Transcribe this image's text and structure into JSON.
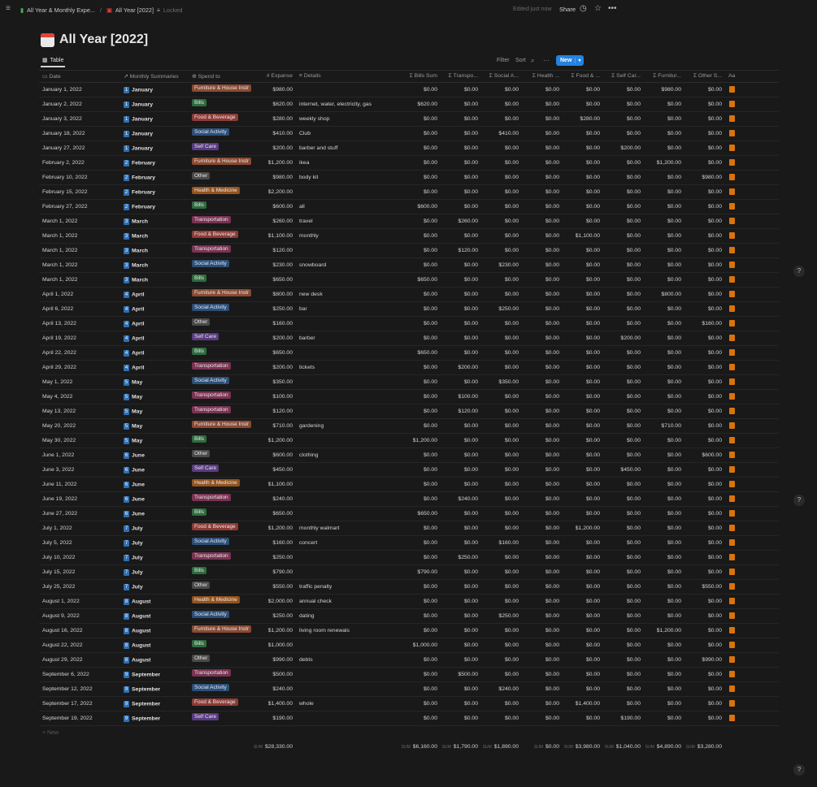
{
  "topbar": {
    "breadcrumb_parent": "All Year & Monthly Expe...",
    "breadcrumb_sep": "/",
    "breadcrumb_current": "All Year [2022]",
    "locked": "Locked",
    "edited": "Edited just now",
    "share": "Share"
  },
  "page": {
    "title": "All Year [2022]"
  },
  "view": {
    "tab": "Table",
    "filter": "Filter",
    "sort": "Sort",
    "new": "New"
  },
  "columns": [
    "Date",
    "Monthly Summaries",
    "Spend to",
    "Expanse",
    "Details",
    "Bills Sum",
    "Transpo...",
    "Social A...",
    "Health ...",
    "Food & ...",
    "Self Car...",
    "Furnitur...",
    "Other S...",
    "Aa"
  ],
  "tag_colors": {
    "Furniture & House Instr": "#8a4a33",
    "Bills": "#2e6b3e",
    "Food & Beverage": "#8e3b36",
    "Social Activity": "#2b4f7a",
    "Self Care": "#5a3b82",
    "Other": "#4a4a4a",
    "Health & Medicine": "#93531e",
    "Transportation": "#7a3352"
  },
  "rows": [
    {
      "date": "January 1, 2022",
      "mnum": "1",
      "month": "January",
      "tag": "Furniture & House Instr",
      "exp": "$980.00",
      "details": "",
      "vals": [
        "$0.00",
        "$0.00",
        "$0.00",
        "$0.00",
        "$0.00",
        "$0.00",
        "$980.00",
        "$0.00"
      ]
    },
    {
      "date": "January 2, 2022",
      "mnum": "1",
      "month": "January",
      "tag": "Bills",
      "exp": "$620.00",
      "details": "internet, water, electricity, gas",
      "vals": [
        "$620.00",
        "$0.00",
        "$0.00",
        "$0.00",
        "$0.00",
        "$0.00",
        "$0.00",
        "$0.00"
      ]
    },
    {
      "date": "January 3, 2022",
      "mnum": "1",
      "month": "January",
      "tag": "Food & Beverage",
      "exp": "$280.00",
      "details": "weekly shop",
      "vals": [
        "$0.00",
        "$0.00",
        "$0.00",
        "$0.00",
        "$280.00",
        "$0.00",
        "$0.00",
        "$0.00"
      ]
    },
    {
      "date": "January 18, 2022",
      "mnum": "1",
      "month": "January",
      "tag": "Social Activity",
      "exp": "$410.00",
      "details": "Club",
      "vals": [
        "$0.00",
        "$0.00",
        "$410.00",
        "$0.00",
        "$0.00",
        "$0.00",
        "$0.00",
        "$0.00"
      ]
    },
    {
      "date": "January 27, 2022",
      "mnum": "1",
      "month": "January",
      "tag": "Self Care",
      "exp": "$200.00",
      "details": "barber and stuff",
      "vals": [
        "$0.00",
        "$0.00",
        "$0.00",
        "$0.00",
        "$0.00",
        "$200.00",
        "$0.00",
        "$0.00"
      ]
    },
    {
      "date": "February 2, 2022",
      "mnum": "2",
      "month": "February",
      "tag": "Furniture & House Instr",
      "exp": "$1,200.00",
      "details": "ikea",
      "vals": [
        "$0.00",
        "$0.00",
        "$0.00",
        "$0.00",
        "$0.00",
        "$0.00",
        "$1,200.00",
        "$0.00"
      ]
    },
    {
      "date": "February 10, 2022",
      "mnum": "2",
      "month": "February",
      "tag": "Other",
      "exp": "$980.00",
      "details": "body kit",
      "vals": [
        "$0.00",
        "$0.00",
        "$0.00",
        "$0.00",
        "$0.00",
        "$0.00",
        "$0.00",
        "$980.00"
      ]
    },
    {
      "date": "February 15, 2022",
      "mnum": "2",
      "month": "February",
      "tag": "Health & Medicine",
      "exp": "$2,200.00",
      "details": "",
      "vals": [
        "$0.00",
        "$0.00",
        "$0.00",
        "$0.00",
        "$0.00",
        "$0.00",
        "$0.00",
        "$0.00"
      ]
    },
    {
      "date": "February 27, 2022",
      "mnum": "2",
      "month": "February",
      "tag": "Bills",
      "exp": "$600.00",
      "details": "all",
      "vals": [
        "$600.00",
        "$0.00",
        "$0.00",
        "$0.00",
        "$0.00",
        "$0.00",
        "$0.00",
        "$0.00"
      ]
    },
    {
      "date": "March 1, 2022",
      "mnum": "3",
      "month": "March",
      "tag": "Transportation",
      "exp": "$260.00",
      "details": "travel",
      "vals": [
        "$0.00",
        "$260.00",
        "$0.00",
        "$0.00",
        "$0.00",
        "$0.00",
        "$0.00",
        "$0.00"
      ]
    },
    {
      "date": "March 1, 2022",
      "mnum": "3",
      "month": "March",
      "tag": "Food & Beverage",
      "exp": "$1,100.00",
      "details": "monthly",
      "vals": [
        "$0.00",
        "$0.00",
        "$0.00",
        "$0.00",
        "$1,100.00",
        "$0.00",
        "$0.00",
        "$0.00"
      ]
    },
    {
      "date": "March 1, 2022",
      "mnum": "3",
      "month": "March",
      "tag": "Transportation",
      "exp": "$120.00",
      "details": "",
      "vals": [
        "$0.00",
        "$120.00",
        "$0.00",
        "$0.00",
        "$0.00",
        "$0.00",
        "$0.00",
        "$0.00"
      ]
    },
    {
      "date": "March 1, 2022",
      "mnum": "3",
      "month": "March",
      "tag": "Social Activity",
      "exp": "$230.00",
      "details": "snowboard",
      "vals": [
        "$0.00",
        "$0.00",
        "$230.00",
        "$0.00",
        "$0.00",
        "$0.00",
        "$0.00",
        "$0.00"
      ]
    },
    {
      "date": "March 1, 2022",
      "mnum": "3",
      "month": "March",
      "tag": "Bills",
      "exp": "$650.00",
      "details": "",
      "vals": [
        "$650.00",
        "$0.00",
        "$0.00",
        "$0.00",
        "$0.00",
        "$0.00",
        "$0.00",
        "$0.00"
      ]
    },
    {
      "date": "April 1, 2022",
      "mnum": "4",
      "month": "April",
      "tag": "Furniture & House Instr",
      "exp": "$800.00",
      "details": "new desk",
      "vals": [
        "$0.00",
        "$0.00",
        "$0.00",
        "$0.00",
        "$0.00",
        "$0.00",
        "$800.00",
        "$0.00"
      ]
    },
    {
      "date": "April 6, 2022",
      "mnum": "4",
      "month": "April",
      "tag": "Social Activity",
      "exp": "$250.00",
      "details": "bar",
      "vals": [
        "$0.00",
        "$0.00",
        "$250.00",
        "$0.00",
        "$0.00",
        "$0.00",
        "$0.00",
        "$0.00"
      ]
    },
    {
      "date": "April 13, 2022",
      "mnum": "4",
      "month": "April",
      "tag": "Other",
      "exp": "$160.00",
      "details": "",
      "vals": [
        "$0.00",
        "$0.00",
        "$0.00",
        "$0.00",
        "$0.00",
        "$0.00",
        "$0.00",
        "$160.00"
      ]
    },
    {
      "date": "April 19, 2022",
      "mnum": "4",
      "month": "April",
      "tag": "Self Care",
      "exp": "$200.00",
      "details": "barber",
      "vals": [
        "$0.00",
        "$0.00",
        "$0.00",
        "$0.00",
        "$0.00",
        "$200.00",
        "$0.00",
        "$0.00"
      ]
    },
    {
      "date": "April 22, 2022",
      "mnum": "4",
      "month": "April",
      "tag": "Bills",
      "exp": "$650.00",
      "details": "",
      "vals": [
        "$650.00",
        "$0.00",
        "$0.00",
        "$0.00",
        "$0.00",
        "$0.00",
        "$0.00",
        "$0.00"
      ]
    },
    {
      "date": "April 29, 2022",
      "mnum": "4",
      "month": "April",
      "tag": "Transportation",
      "exp": "$200.00",
      "details": "tickets",
      "vals": [
        "$0.00",
        "$200.00",
        "$0.00",
        "$0.00",
        "$0.00",
        "$0.00",
        "$0.00",
        "$0.00"
      ]
    },
    {
      "date": "May 1, 2022",
      "mnum": "5",
      "month": "May",
      "tag": "Social Activity",
      "exp": "$350.00",
      "details": "",
      "vals": [
        "$0.00",
        "$0.00",
        "$350.00",
        "$0.00",
        "$0.00",
        "$0.00",
        "$0.00",
        "$0.00"
      ]
    },
    {
      "date": "May 4, 2022",
      "mnum": "5",
      "month": "May",
      "tag": "Transportation",
      "exp": "$100.00",
      "details": "",
      "vals": [
        "$0.00",
        "$100.00",
        "$0.00",
        "$0.00",
        "$0.00",
        "$0.00",
        "$0.00",
        "$0.00"
      ]
    },
    {
      "date": "May 13, 2022",
      "mnum": "5",
      "month": "May",
      "tag": "Transportation",
      "exp": "$120.00",
      "details": "",
      "vals": [
        "$0.00",
        "$120.00",
        "$0.00",
        "$0.00",
        "$0.00",
        "$0.00",
        "$0.00",
        "$0.00"
      ]
    },
    {
      "date": "May 20, 2022",
      "mnum": "5",
      "month": "May",
      "tag": "Furniture & House Instr",
      "exp": "$710.00",
      "details": "gardening",
      "vals": [
        "$0.00",
        "$0.00",
        "$0.00",
        "$0.00",
        "$0.00",
        "$0.00",
        "$710.00",
        "$0.00"
      ]
    },
    {
      "date": "May 30, 2022",
      "mnum": "5",
      "month": "May",
      "tag": "Bills",
      "exp": "$1,200.00",
      "details": "",
      "vals": [
        "$1,200.00",
        "$0.00",
        "$0.00",
        "$0.00",
        "$0.00",
        "$0.00",
        "$0.00",
        "$0.00"
      ]
    },
    {
      "date": "June 1, 2022",
      "mnum": "6",
      "month": "June",
      "tag": "Other",
      "exp": "$600.00",
      "details": "clothing",
      "vals": [
        "$0.00",
        "$0.00",
        "$0.00",
        "$0.00",
        "$0.00",
        "$0.00",
        "$0.00",
        "$600.00"
      ]
    },
    {
      "date": "June 3, 2022",
      "mnum": "6",
      "month": "June",
      "tag": "Self Care",
      "exp": "$450.00",
      "details": "",
      "vals": [
        "$0.00",
        "$0.00",
        "$0.00",
        "$0.00",
        "$0.00",
        "$450.00",
        "$0.00",
        "$0.00"
      ]
    },
    {
      "date": "June 11, 2022",
      "mnum": "6",
      "month": "June",
      "tag": "Health & Medicine",
      "exp": "$1,100.00",
      "details": "",
      "vals": [
        "$0.00",
        "$0.00",
        "$0.00",
        "$0.00",
        "$0.00",
        "$0.00",
        "$0.00",
        "$0.00"
      ]
    },
    {
      "date": "June 19, 2022",
      "mnum": "6",
      "month": "June",
      "tag": "Transportation",
      "exp": "$240.00",
      "details": "",
      "vals": [
        "$0.00",
        "$240.00",
        "$0.00",
        "$0.00",
        "$0.00",
        "$0.00",
        "$0.00",
        "$0.00"
      ]
    },
    {
      "date": "June 27, 2022",
      "mnum": "6",
      "month": "June",
      "tag": "Bills",
      "exp": "$650.00",
      "details": "",
      "vals": [
        "$650.00",
        "$0.00",
        "$0.00",
        "$0.00",
        "$0.00",
        "$0.00",
        "$0.00",
        "$0.00"
      ]
    },
    {
      "date": "July 1, 2022",
      "mnum": "7",
      "month": "July",
      "tag": "Food & Beverage",
      "exp": "$1,200.00",
      "details": "monthly walmart",
      "vals": [
        "$0.00",
        "$0.00",
        "$0.00",
        "$0.00",
        "$1,200.00",
        "$0.00",
        "$0.00",
        "$0.00"
      ]
    },
    {
      "date": "July 5, 2022",
      "mnum": "7",
      "month": "July",
      "tag": "Social Activity",
      "exp": "$160.00",
      "details": "concert",
      "vals": [
        "$0.00",
        "$0.00",
        "$160.00",
        "$0.00",
        "$0.00",
        "$0.00",
        "$0.00",
        "$0.00"
      ]
    },
    {
      "date": "July 10, 2022",
      "mnum": "7",
      "month": "July",
      "tag": "Transportation",
      "exp": "$250.00",
      "details": "",
      "vals": [
        "$0.00",
        "$250.00",
        "$0.00",
        "$0.00",
        "$0.00",
        "$0.00",
        "$0.00",
        "$0.00"
      ]
    },
    {
      "date": "July 15, 2022",
      "mnum": "7",
      "month": "July",
      "tag": "Bills",
      "exp": "$790.00",
      "details": "",
      "vals": [
        "$790.00",
        "$0.00",
        "$0.00",
        "$0.00",
        "$0.00",
        "$0.00",
        "$0.00",
        "$0.00"
      ]
    },
    {
      "date": "July 25, 2022",
      "mnum": "7",
      "month": "July",
      "tag": "Other",
      "exp": "$550.00",
      "details": "traffic penalty",
      "vals": [
        "$0.00",
        "$0.00",
        "$0.00",
        "$0.00",
        "$0.00",
        "$0.00",
        "$0.00",
        "$550.00"
      ]
    },
    {
      "date": "August 1, 2022",
      "mnum": "8",
      "month": "August",
      "tag": "Health & Medicine",
      "exp": "$2,000.00",
      "details": "annual check",
      "vals": [
        "$0.00",
        "$0.00",
        "$0.00",
        "$0.00",
        "$0.00",
        "$0.00",
        "$0.00",
        "$0.00"
      ]
    },
    {
      "date": "August 9, 2022",
      "mnum": "8",
      "month": "August",
      "tag": "Social Activity",
      "exp": "$250.00",
      "details": "dating",
      "vals": [
        "$0.00",
        "$0.00",
        "$250.00",
        "$0.00",
        "$0.00",
        "$0.00",
        "$0.00",
        "$0.00"
      ]
    },
    {
      "date": "August 16, 2022",
      "mnum": "8",
      "month": "August",
      "tag": "Furniture & House Instr",
      "exp": "$1,200.00",
      "details": "living room renewals",
      "vals": [
        "$0.00",
        "$0.00",
        "$0.00",
        "$0.00",
        "$0.00",
        "$0.00",
        "$1,200.00",
        "$0.00"
      ]
    },
    {
      "date": "August 22, 2022",
      "mnum": "8",
      "month": "August",
      "tag": "Bills",
      "exp": "$1,000.00",
      "details": "",
      "vals": [
        "$1,000.00",
        "$0.00",
        "$0.00",
        "$0.00",
        "$0.00",
        "$0.00",
        "$0.00",
        "$0.00"
      ]
    },
    {
      "date": "August 29, 2022",
      "mnum": "8",
      "month": "August",
      "tag": "Other",
      "exp": "$990.00",
      "details": "debts",
      "vals": [
        "$0.00",
        "$0.00",
        "$0.00",
        "$0.00",
        "$0.00",
        "$0.00",
        "$0.00",
        "$990.00"
      ]
    },
    {
      "date": "September 6, 2022",
      "mnum": "9",
      "month": "September",
      "tag": "Transportation",
      "exp": "$500.00",
      "details": "",
      "vals": [
        "$0.00",
        "$500.00",
        "$0.00",
        "$0.00",
        "$0.00",
        "$0.00",
        "$0.00",
        "$0.00"
      ]
    },
    {
      "date": "September 12, 2022",
      "mnum": "9",
      "month": "September",
      "tag": "Social Activity",
      "exp": "$240.00",
      "details": "",
      "vals": [
        "$0.00",
        "$0.00",
        "$240.00",
        "$0.00",
        "$0.00",
        "$0.00",
        "$0.00",
        "$0.00"
      ]
    },
    {
      "date": "September 17, 2022",
      "mnum": "9",
      "month": "September",
      "tag": "Food & Beverage",
      "exp": "$1,400.00",
      "details": "whole",
      "vals": [
        "$0.00",
        "$0.00",
        "$0.00",
        "$0.00",
        "$1,400.00",
        "$0.00",
        "$0.00",
        "$0.00"
      ]
    },
    {
      "date": "September 19, 2022",
      "mnum": "9",
      "month": "September",
      "tag": "Self Care",
      "exp": "$190.00",
      "details": "",
      "vals": [
        "$0.00",
        "$0.00",
        "$0.00",
        "$0.00",
        "$0.00",
        "$190.00",
        "$0.00",
        "$0.00"
      ]
    }
  ],
  "new_row": "New",
  "sum_label": "SUM",
  "sums": {
    "expanse": "$28,330.00",
    "cols": [
      "$6,160.00",
      "$1,790.00",
      "$1,890.00",
      "$0.00",
      "$3,980.00",
      "$1,040.00",
      "$4,890.00",
      "$3,280.00"
    ]
  },
  "help": "?"
}
